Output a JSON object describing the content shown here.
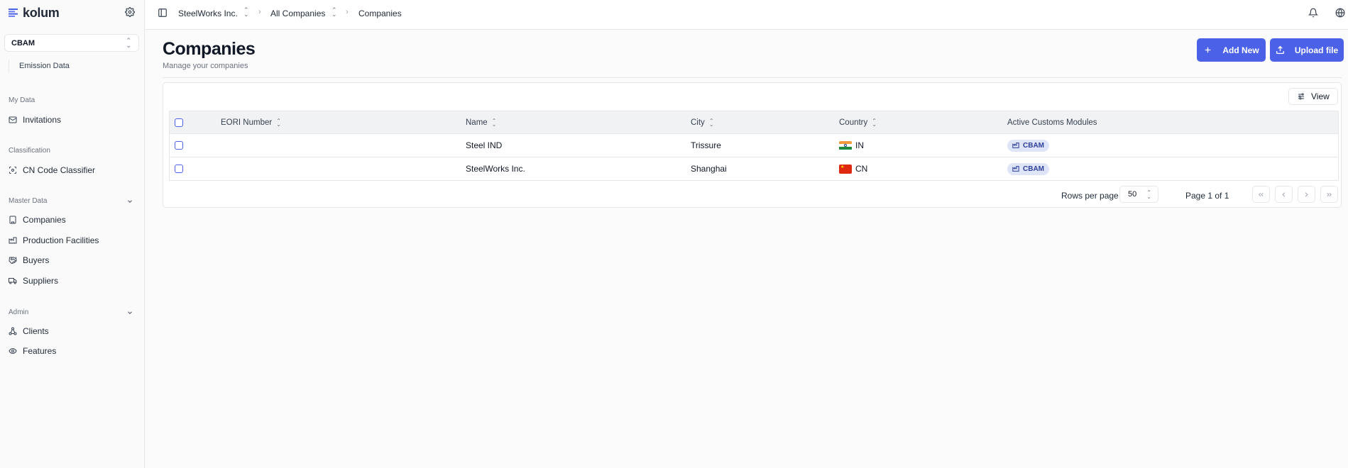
{
  "app": {
    "name": "kolum",
    "accent_color": "#4a61e8"
  },
  "sidebar": {
    "module_select": "CBAM",
    "module_subitem": "Emission Data",
    "groups": [
      {
        "label": "My Data",
        "items": [
          {
            "label": "Invitations",
            "icon": "mail-icon"
          }
        ]
      },
      {
        "label": "Classification",
        "items": [
          {
            "label": "CN Code Classifier",
            "icon": "scan-icon"
          }
        ]
      },
      {
        "label": "Master Data",
        "collapsible": true,
        "items": [
          {
            "label": "Companies",
            "icon": "building-icon"
          },
          {
            "label": "Production Facilities",
            "icon": "factory-icon"
          },
          {
            "label": "Buyers",
            "icon": "handshake-icon"
          },
          {
            "label": "Suppliers",
            "icon": "truck-icon"
          }
        ]
      },
      {
        "label": "Admin",
        "collapsible": true,
        "items": [
          {
            "label": "Clients",
            "icon": "network-icon"
          },
          {
            "label": "Features",
            "icon": "eye-icon"
          }
        ]
      }
    ]
  },
  "topbar": {
    "breadcrumbs": [
      "SteelWorks Inc.",
      "All Companies",
      "Companies"
    ]
  },
  "page": {
    "title": "Companies",
    "subtitle": "Manage your companies",
    "add_button": "Add New",
    "upload_button": "Upload file",
    "view_button": "View"
  },
  "table": {
    "columns": [
      "EORI Number",
      "Name",
      "City",
      "Country",
      "Active Customs Modules"
    ],
    "rows": [
      {
        "eori": "",
        "name": "Steel IND",
        "city": "Trissure",
        "country_code": "IN",
        "flag": "india-flag-icon",
        "module": "CBAM"
      },
      {
        "eori": "",
        "name": "SteelWorks Inc.",
        "city": "Shanghai",
        "country_code": "CN",
        "flag": "china-flag-icon",
        "module": "CBAM"
      }
    ]
  },
  "pagination": {
    "rows_per_page_label": "Rows per page",
    "rows_per_page": "50",
    "page_info": "Page 1 of 1"
  }
}
